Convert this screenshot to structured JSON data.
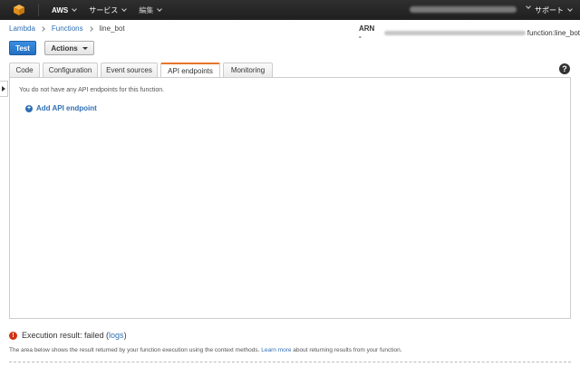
{
  "topbar": {
    "brand": "AWS",
    "services": "サービス",
    "edit": "編集",
    "support": "サポート"
  },
  "breadcrumb": {
    "items": [
      "Lambda",
      "Functions"
    ],
    "current": "line_bot"
  },
  "arn": {
    "label": "ARN -",
    "suffix": "function:line_bot"
  },
  "toolbar": {
    "test_label": "Test",
    "actions_label": "Actions"
  },
  "tabs": [
    {
      "label": "Code"
    },
    {
      "label": "Configuration"
    },
    {
      "label": "Event sources"
    },
    {
      "label": "API endpoints",
      "active": true
    },
    {
      "label": "Monitoring"
    }
  ],
  "panel": {
    "empty_message": "You do not have any API endpoints for this function.",
    "add_label": "Add API endpoint"
  },
  "execution": {
    "prefix": "Execution result: failed (",
    "logs_label": "logs",
    "suffix": ")",
    "desc_before": "The area below shows the result returned by your function execution using the context methods. ",
    "learn_more": "Learn more",
    "desc_after": " about returning results from your function."
  },
  "colors": {
    "accent": "#2f6fb3",
    "active_tab": "#e8742b",
    "error": "#d13212",
    "topbar": "#232f3e"
  }
}
